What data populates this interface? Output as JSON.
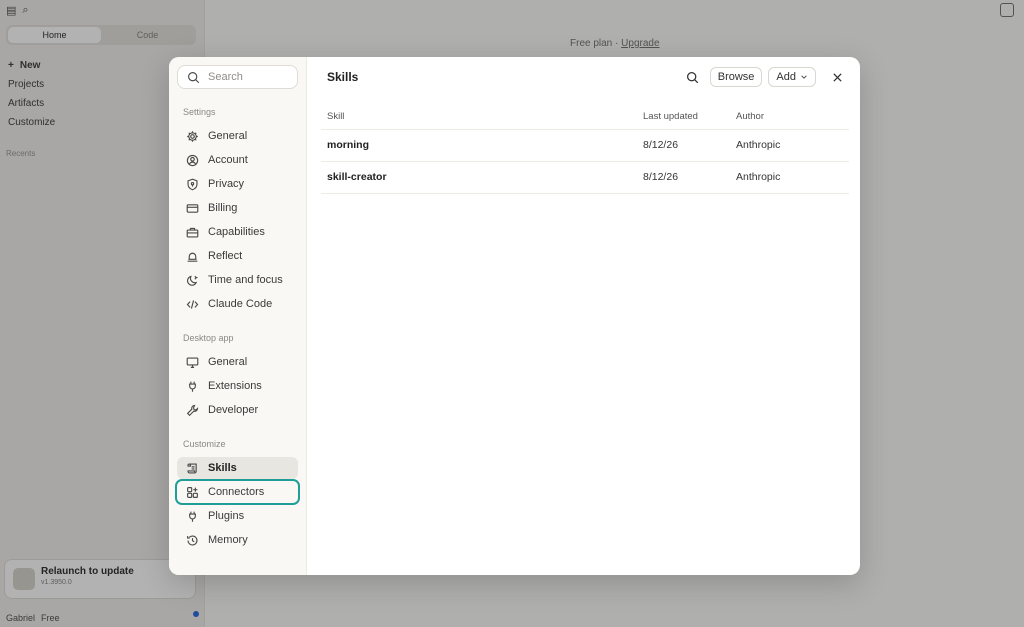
{
  "background": {
    "tabs": [
      "Home",
      "Code"
    ],
    "nav": [
      "New",
      "Projects",
      "Artifacts",
      "Customize"
    ],
    "recents_label": "Recents",
    "plan_text": "Free plan",
    "plan_sep": "·",
    "upgrade_label": "Upgrade",
    "relaunch_title": "Relaunch to update",
    "relaunch_version": "v1.3950.0",
    "user_name": "Gabriel",
    "user_plan": "Free"
  },
  "modal": {
    "search_placeholder": "Search",
    "sections": {
      "settings": "Settings",
      "desktop": "Desktop app",
      "customize": "Customize"
    },
    "settings_items": [
      {
        "label": "General",
        "icon": "gear-icon"
      },
      {
        "label": "Account",
        "icon": "user-circle-icon"
      },
      {
        "label": "Privacy",
        "icon": "shield-icon"
      },
      {
        "label": "Billing",
        "icon": "credit-card-icon"
      },
      {
        "label": "Capabilities",
        "icon": "toolbox-icon"
      },
      {
        "label": "Reflect",
        "icon": "bell-icon"
      },
      {
        "label": "Time and focus",
        "icon": "moon-icon"
      },
      {
        "label": "Claude Code",
        "icon": "code-icon"
      }
    ],
    "desktop_items": [
      {
        "label": "General",
        "icon": "monitor-icon"
      },
      {
        "label": "Extensions",
        "icon": "plug-icon"
      },
      {
        "label": "Developer",
        "icon": "wrench-icon"
      }
    ],
    "customize_items": [
      {
        "label": "Skills",
        "icon": "scroll-icon"
      },
      {
        "label": "Connectors",
        "icon": "connectors-icon"
      },
      {
        "label": "Plugins",
        "icon": "plug-icon"
      },
      {
        "label": "Memory",
        "icon": "history-icon"
      }
    ],
    "title": "Skills",
    "browse_label": "Browse",
    "add_label": "Add",
    "table": {
      "headers": [
        "Skill",
        "Last updated",
        "Author"
      ],
      "rows": [
        {
          "skill": "morning",
          "updated": "8/12/26",
          "author": "Anthropic"
        },
        {
          "skill": "skill-creator",
          "updated": "8/12/26",
          "author": "Anthropic"
        }
      ]
    }
  }
}
